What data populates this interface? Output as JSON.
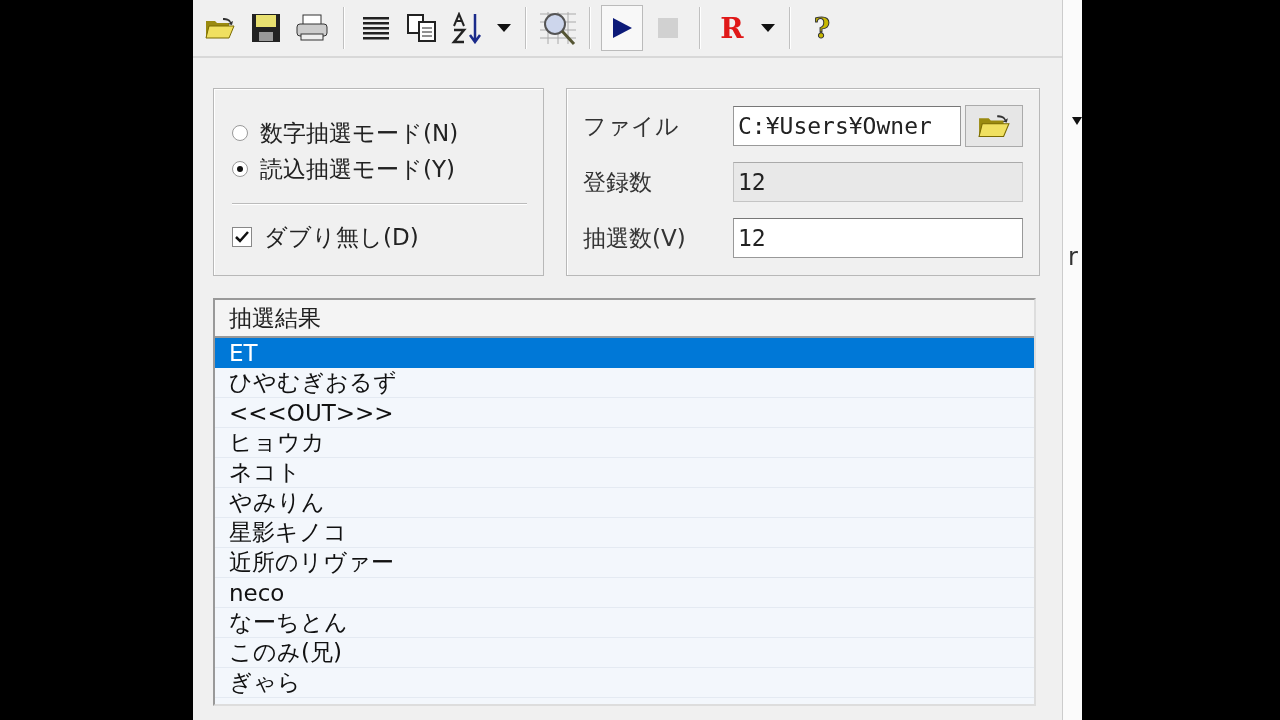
{
  "toolbar": [
    {
      "kind": "open",
      "pressed": false,
      "disabled": false
    },
    {
      "kind": "save",
      "pressed": false,
      "disabled": false
    },
    {
      "kind": "print",
      "pressed": false,
      "disabled": false
    },
    {
      "kind": "separator"
    },
    {
      "kind": "list",
      "pressed": false,
      "disabled": false
    },
    {
      "kind": "copy",
      "pressed": false,
      "disabled": false
    },
    {
      "kind": "sort",
      "pressed": false,
      "disabled": false
    },
    {
      "kind": "caret",
      "pressed": false,
      "disabled": false
    },
    {
      "kind": "separator"
    },
    {
      "kind": "inspect",
      "pressed": false,
      "disabled": false
    },
    {
      "kind": "separator"
    },
    {
      "kind": "play",
      "pressed": true,
      "disabled": false
    },
    {
      "kind": "stop",
      "pressed": false,
      "disabled": true
    },
    {
      "kind": "separator"
    },
    {
      "kind": "letter",
      "text": "R",
      "pressed": false,
      "disabled": false
    },
    {
      "kind": "caret",
      "pressed": false,
      "disabled": false
    },
    {
      "kind": "separator"
    },
    {
      "kind": "letter_help",
      "text": "?",
      "pressed": false,
      "disabled": false
    }
  ],
  "mode": {
    "options": [
      {
        "label": "数字抽選モード(N)",
        "selected": false
      },
      {
        "label": "読込抽選モード(Y)",
        "selected": true
      }
    ],
    "no_duplicates": {
      "label": "ダブり無し(D)",
      "checked": true
    }
  },
  "fields": [
    {
      "kind": "file",
      "label": "ファイル",
      "value": "C:¥Users¥Owner",
      "disabled": false
    },
    {
      "kind": "text",
      "label": "登録数",
      "value": "12",
      "disabled": true
    },
    {
      "kind": "text",
      "label": "抽選数(V)",
      "value": "12",
      "disabled": false
    }
  ],
  "results": {
    "column": "抽選結果",
    "rows": [
      {
        "name": "ET",
        "selected": true
      },
      {
        "name": "ひやむぎおるず",
        "selected": false
      },
      {
        "name": "<<<OUT>>>",
        "selected": false
      },
      {
        "name": "ヒョウカ",
        "selected": false
      },
      {
        "name": "ネコト",
        "selected": false
      },
      {
        "name": "やみりん",
        "selected": false
      },
      {
        "name": "星影キノコ",
        "selected": false
      },
      {
        "name": "近所のリヴァー",
        "selected": false
      },
      {
        "name": "neco",
        "selected": false
      },
      {
        "name": "なーちとん",
        "selected": false
      },
      {
        "name": "このみ(兄)",
        "selected": false
      },
      {
        "name": "ぎゃら",
        "selected": false
      }
    ]
  },
  "side_window": {
    "text": "r"
  }
}
